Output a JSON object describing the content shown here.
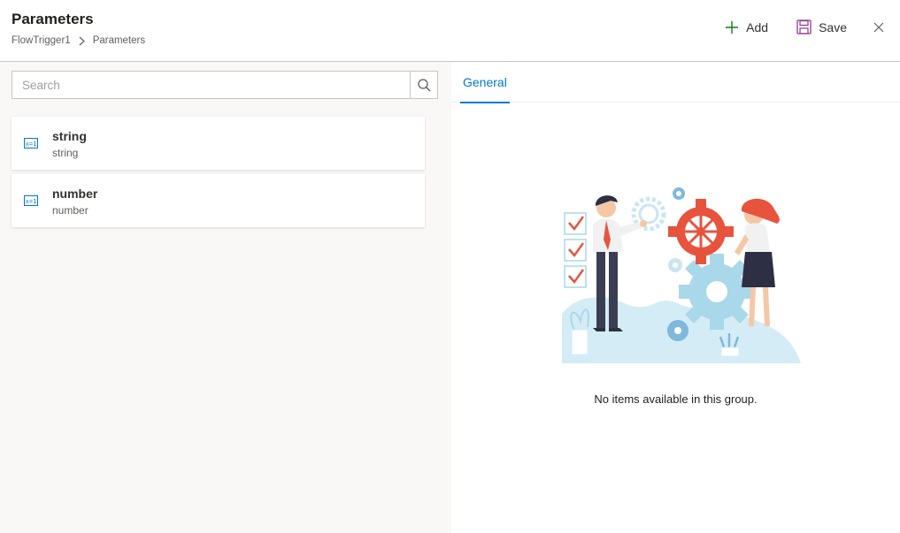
{
  "header": {
    "title": "Parameters",
    "breadcrumb": [
      "FlowTrigger1",
      "Parameters"
    ],
    "add_label": "Add",
    "save_label": "Save"
  },
  "search": {
    "placeholder": "Search",
    "value": ""
  },
  "parameters": [
    {
      "name": "string",
      "type": "string",
      "icon": "parameter-icon"
    },
    {
      "name": "number",
      "type": "number",
      "icon": "parameter-icon"
    }
  ],
  "detail": {
    "tabs": [
      {
        "label": "General",
        "selected": true
      }
    ],
    "empty_message": "No items available in this group."
  },
  "colors": {
    "accent": "#0078d4",
    "add_icon": "#107c10",
    "save_icon": "#8a3a93",
    "illustration_red": "#e8533d",
    "illustration_blue": "#a8d8ea"
  }
}
